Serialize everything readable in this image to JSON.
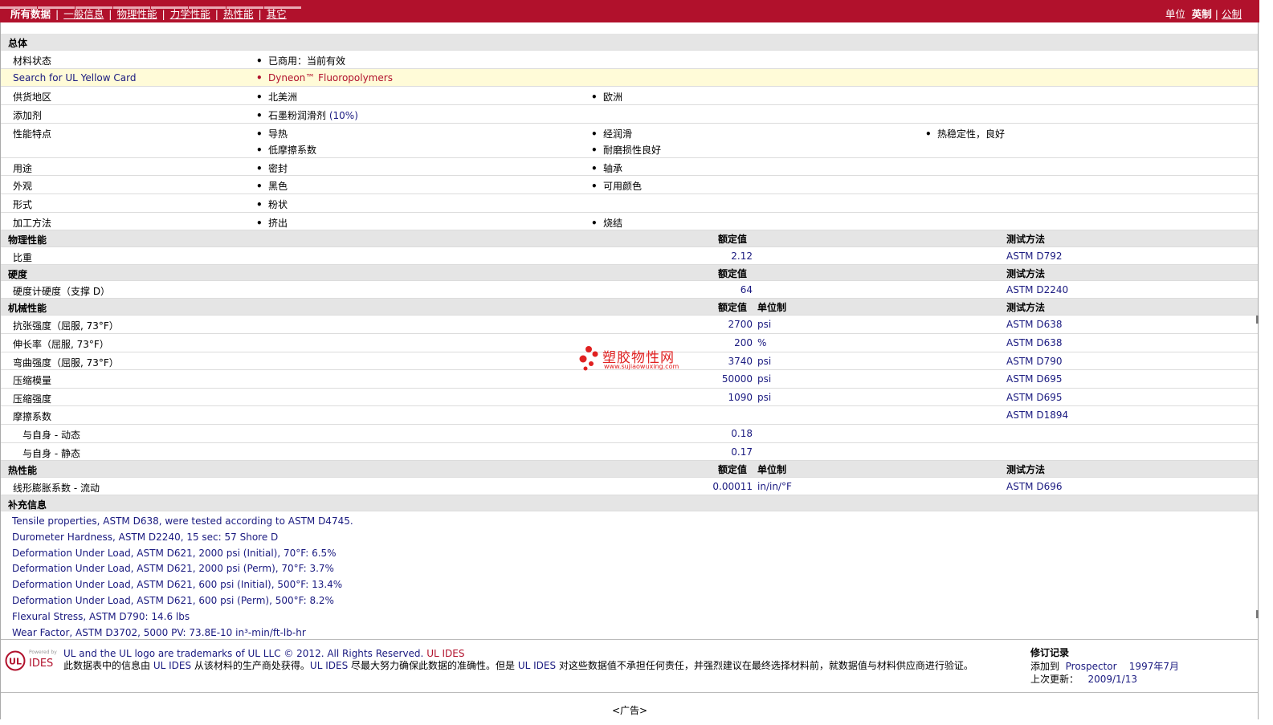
{
  "nav": {
    "current": "所有数据",
    "links": [
      "一般信息",
      "物理性能",
      "力学性能",
      "热性能",
      "其它"
    ],
    "unit_label": "单位",
    "unit_imperial": "英制",
    "unit_metric": "公制"
  },
  "general": {
    "title": "总体",
    "rows": [
      {
        "label": "材料状态",
        "values": [
          "已商用：当前有效"
        ]
      },
      {
        "label": "Search for UL Yellow Card",
        "values": [
          "Dyneon™ Fluoropolymers"
        ]
      },
      {
        "label": "供货地区",
        "values": [
          "北美洲",
          "欧洲"
        ]
      },
      {
        "label": "添加剂",
        "values": [
          "石墨粉润滑剂"
        ],
        "extra": "(10%)"
      },
      {
        "label": "性能特点",
        "values": [
          "导热",
          "经润滑",
          "热稳定性，良好",
          "低摩擦系数",
          "耐磨损性良好"
        ]
      },
      {
        "label": "用途",
        "values": [
          "密封",
          "轴承"
        ]
      },
      {
        "label": "外观",
        "values": [
          "黑色",
          "可用颜色"
        ]
      },
      {
        "label": "形式",
        "values": [
          "粉状"
        ]
      },
      {
        "label": "加工方法",
        "values": [
          "挤出",
          "烧结"
        ]
      }
    ]
  },
  "headers": {
    "nominal": "额定值",
    "unit": "单位制",
    "method": "测试方法"
  },
  "physical": {
    "title": "物理性能",
    "rows": [
      {
        "label": "比重",
        "value": "2.12",
        "unit": "",
        "method": "ASTM D792"
      }
    ]
  },
  "hardness": {
    "title": "硬度",
    "rows": [
      {
        "label": "硬度计硬度（支撑 D）",
        "value": "64",
        "unit": "",
        "method": "ASTM D2240"
      }
    ]
  },
  "mechanical": {
    "title": "机械性能",
    "rows": [
      {
        "label": "抗张强度（屈服, 73°F）",
        "value": "2700",
        "unit": "psi",
        "method": "ASTM D638"
      },
      {
        "label": "伸长率（屈服, 73°F）",
        "value": "200",
        "unit": "%",
        "method": "ASTM D638"
      },
      {
        "label": "弯曲强度（屈服, 73°F）",
        "value": "3740",
        "unit": "psi",
        "method": "ASTM D790"
      },
      {
        "label": "压缩模量",
        "value": "50000",
        "unit": "psi",
        "method": "ASTM D695"
      },
      {
        "label": "压缩强度",
        "value": "1090",
        "unit": "psi",
        "method": "ASTM D695"
      },
      {
        "label": "摩擦系数",
        "value": "",
        "unit": "",
        "method": "ASTM D1894"
      },
      {
        "label": "与自身  - 动态",
        "value": "0.18",
        "unit": "",
        "method": "",
        "indent": true
      },
      {
        "label": "与自身  - 静态",
        "value": "0.17",
        "unit": "",
        "method": "",
        "indent": true
      }
    ]
  },
  "thermal": {
    "title": "热性能",
    "rows": [
      {
        "label": "线形膨胀系数  - 流动",
        "value": "0.00011",
        "unit": "in/in/°F",
        "method": "ASTM D696"
      }
    ]
  },
  "supplement": {
    "title": "补充信息",
    "lines": [
      "Tensile properties, ASTM D638, were tested according to ASTM D4745.",
      "Durometer Hardness, ASTM D2240, 15 sec: 57 Shore D",
      "Deformation Under Load, ASTM D621, 2000 psi (Initial), 70°F: 6.5%",
      "Deformation Under Load, ASTM D621, 2000 psi (Perm), 70°F: 3.7%",
      "Deformation Under Load, ASTM D621, 600 psi (Initial), 500°F: 13.4%",
      "Deformation Under Load, ASTM D621, 600 psi (Perm), 500°F: 8.2%",
      "Flexural Stress, ASTM D790: 14.6 lbs",
      "Wear Factor, ASTM D3702, 5000 PV: 73.8E-10 in³-min/ft-lb-hr"
    ]
  },
  "footer": {
    "logo_powered": "Powered by",
    "logo_ul": "UL",
    "logo_ides": "IDES",
    "trademark": "UL and the UL logo are trademarks of UL LLC © 2012. All Rights Reserved.",
    "trademark_link": "UL IDES",
    "disclaimer_1": "此数据表中的信息由 ",
    "disclaimer_ides1": "UL IDES",
    "disclaimer_2": " 从该材料的生产商处获得。",
    "disclaimer_ides2": "UL IDES",
    "disclaimer_3": " 尽最大努力确保此数据的准确性。但是 ",
    "disclaimer_ides3": "UL IDES",
    "disclaimer_4": " 对这些数据值不承担任何责任，并强烈建议在最终选择材料前，就数据值与材料供应商进行验证。",
    "rev_title": "修订记录",
    "rev_added_label": "添加到",
    "rev_added_link": "Prospector",
    "rev_added_date": "1997年7月",
    "rev_updated_label": "上次更新：",
    "rev_updated_date": "2009/1/13",
    "ad": "<广告>"
  },
  "watermark": {
    "cn": "塑胶物性网",
    "url": "www.sujiaowuxing.com"
  },
  "colors": {
    "brand": "#b1112c",
    "section_bg": "#e5e5e5",
    "highlight": "#fffbd8",
    "value_text": "#1a1a80"
  }
}
